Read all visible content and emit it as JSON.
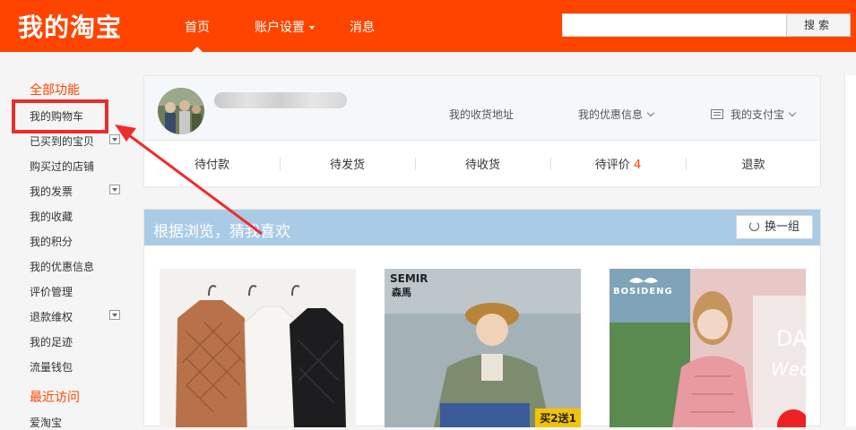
{
  "header": {
    "brand": "我的淘宝",
    "nav": [
      {
        "label": "首页"
      },
      {
        "label": "账户设置"
      },
      {
        "label": "消息"
      }
    ],
    "search_button": "搜索"
  },
  "sidebar": {
    "section_all": "全部功能",
    "items": [
      {
        "label": "我的购物车"
      },
      {
        "label": "已买到的宝贝"
      },
      {
        "label": "购买过的店铺"
      },
      {
        "label": "我的发票"
      },
      {
        "label": "我的收藏"
      },
      {
        "label": "我的积分"
      },
      {
        "label": "我的优惠信息"
      },
      {
        "label": "评价管理"
      },
      {
        "label": "退款维权"
      },
      {
        "label": "我的足迹"
      },
      {
        "label": "流量钱包"
      }
    ],
    "section_recent": "最近访问",
    "recent_items": [
      {
        "label": "爱淘宝"
      }
    ]
  },
  "user_panel": {
    "links": {
      "address": "我的收货地址",
      "promo": "我的优惠信息",
      "alipay": "我的支付宝"
    },
    "orders": [
      {
        "label": "待付款",
        "count": ""
      },
      {
        "label": "待发货",
        "count": ""
      },
      {
        "label": "待收货",
        "count": ""
      },
      {
        "label": "待评价",
        "count": "4"
      },
      {
        "label": "退款",
        "count": ""
      }
    ]
  },
  "recommend": {
    "title": "根据浏览，猜我喜欢",
    "refresh": "换一组",
    "products": [
      {
        "brand": ""
      },
      {
        "brand": "SEMIR",
        "brand_cn": "森馬",
        "badge": "买2送1"
      },
      {
        "brand": "BOSIDENG",
        "overlay": "DA",
        "overlay2": "Wed"
      }
    ]
  },
  "colors": {
    "brand": "#ff4400",
    "banner": "#a9cbe5",
    "highlight": "#ee2c2c"
  }
}
